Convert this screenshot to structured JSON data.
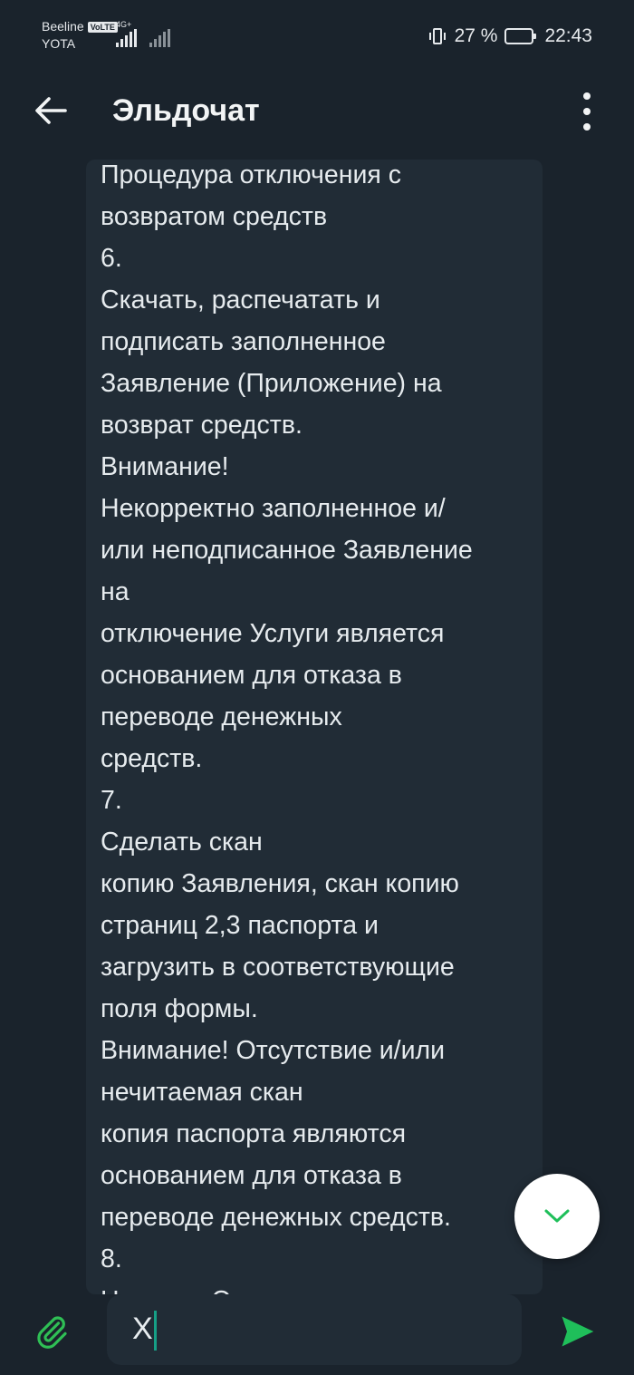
{
  "status_bar": {
    "carrier_1": "Beeline",
    "volte_badge": "VoLTE",
    "carrier_2": "YOTA",
    "network_type": "4G+",
    "battery_percent": "27 %",
    "battery_level": 0.27,
    "time": "22:43"
  },
  "app_bar": {
    "title": "Эльдочат",
    "back_icon": "arrow-left-icon",
    "menu_icon": "more-vert-icon"
  },
  "chat": {
    "message_lines": [
      "Процедура отключения с",
      "возвратом средств",
      "6.",
      "Скачать, распечатать и",
      "подписать заполненное",
      "Заявление (Приложение) на",
      "возврат средств.",
      "Внимание!",
      "Некорректно заполненное и/",
      "или неподписанное Заявление",
      "на",
      "отключение Услуги является",
      "основанием для отказа в",
      "переводе денежных",
      "средств.",
      "7.",
      "Сделать скан",
      "копию Заявления, скан копию",
      "страниц 2,3 паспорта и",
      "загрузить в соответствующие",
      "поля формы.",
      "Внимание! Отсутствие и/или",
      "нечитаемая скан",
      "копия паспорта являются",
      "основанием для отказа в",
      "переводе денежных средств.",
      "8.",
      "Нажать «Отправить»"
    ],
    "scroll_down_icon": "chevron-down-icon"
  },
  "composer": {
    "attach_icon": "paperclip-icon",
    "input_value": "Х",
    "send_icon": "send-icon"
  },
  "colors": {
    "background": "#1a232c",
    "bubble": "#212c36",
    "accent_green": "#1fbf5a",
    "cursor": "#169f86"
  }
}
